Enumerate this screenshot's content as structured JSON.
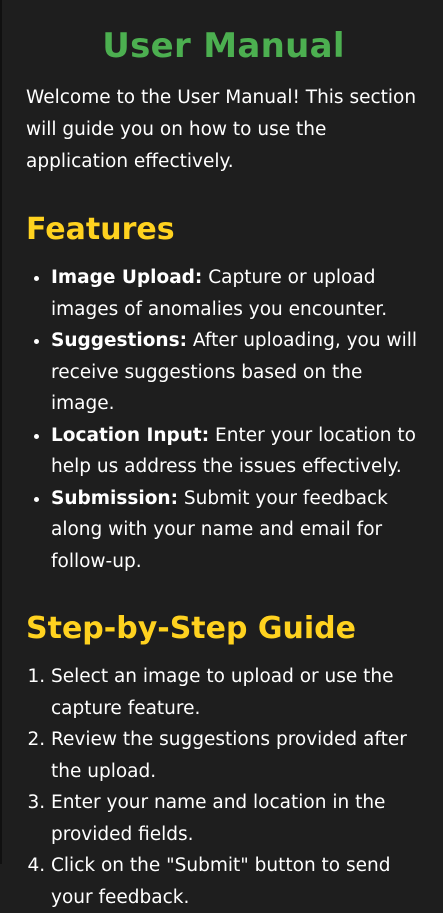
{
  "title": "User Manual",
  "intro": "Welcome to the User Manual! This section will guide you on how to use the application effectively.",
  "features": {
    "heading": "Features",
    "items": [
      {
        "term": "Image Upload:",
        "text": " Capture or upload images of anomalies you encounter."
      },
      {
        "term": "Suggestions:",
        "text": " After uploading, you will receive suggestions based on the image."
      },
      {
        "term": "Location Input:",
        "text": " Enter your location to help us address the issues effectively."
      },
      {
        "term": "Submission:",
        "text": " Submit your feedback along with your name and email for follow-up."
      }
    ]
  },
  "guide": {
    "heading": "Step-by-Step Guide",
    "steps": [
      "Select an image to upload or use the capture feature.",
      "Review the suggestions provided after the upload.",
      "Enter your name and location in the provided fields.",
      "Click on the \"Submit\" button to send your feedback."
    ]
  },
  "colors": {
    "background": "#1e1e1e",
    "title": "#4caf50",
    "section_heading": "#ffd21f",
    "text": "#ffffff"
  }
}
